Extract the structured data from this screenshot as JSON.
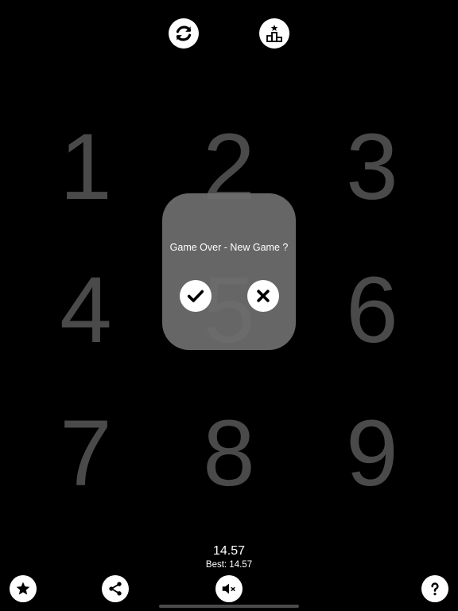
{
  "top_bar": {
    "restart_icon": "refresh-icon",
    "leaderboard_icon": "podium-star-icon"
  },
  "grid": {
    "cells": [
      "1",
      "2",
      "3",
      "4",
      "5",
      "6",
      "7",
      "8",
      "9"
    ]
  },
  "dialog": {
    "title": "Game Over - New Game ?",
    "confirm_icon": "checkmark-icon",
    "cancel_icon": "x-mark-icon"
  },
  "score": {
    "current": "14.57",
    "best": "Best: 14.57"
  },
  "bottom_bar": {
    "favorite_icon": "star-icon",
    "share_icon": "share-icon",
    "sound_icon": "speaker-muted-icon",
    "help_icon": "question-icon"
  },
  "colors": {
    "background": "#000000",
    "digit": "#4a4a4a",
    "dialog": "#6e6e6e",
    "button": "#ffffff"
  }
}
